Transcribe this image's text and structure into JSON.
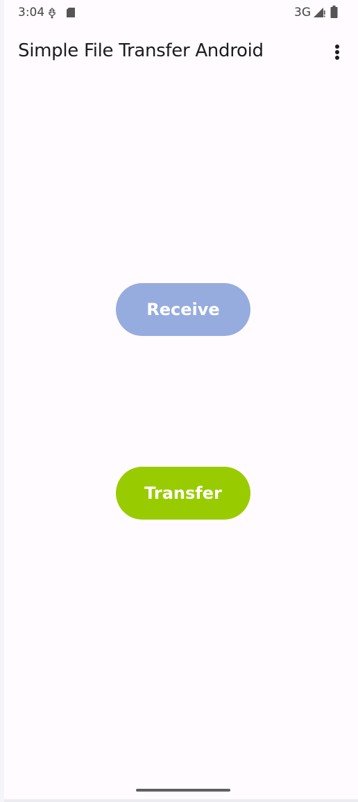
{
  "status_bar": {
    "time": "3:04",
    "network": "3G",
    "icons": [
      "usb-debug-icon",
      "sd-card-icon",
      "signal-icon",
      "battery-icon"
    ]
  },
  "app_bar": {
    "title": "Simple File Transfer Android",
    "overflow_icon": "more-vert-icon"
  },
  "main": {
    "receive_label": "Receive",
    "transfer_label": "Transfer"
  },
  "colors": {
    "background": "#fffbfe",
    "receive_button": "#96acdf",
    "transfer_button": "#99cc00",
    "button_text": "#ffffff",
    "title_text": "#1c1b1f"
  }
}
